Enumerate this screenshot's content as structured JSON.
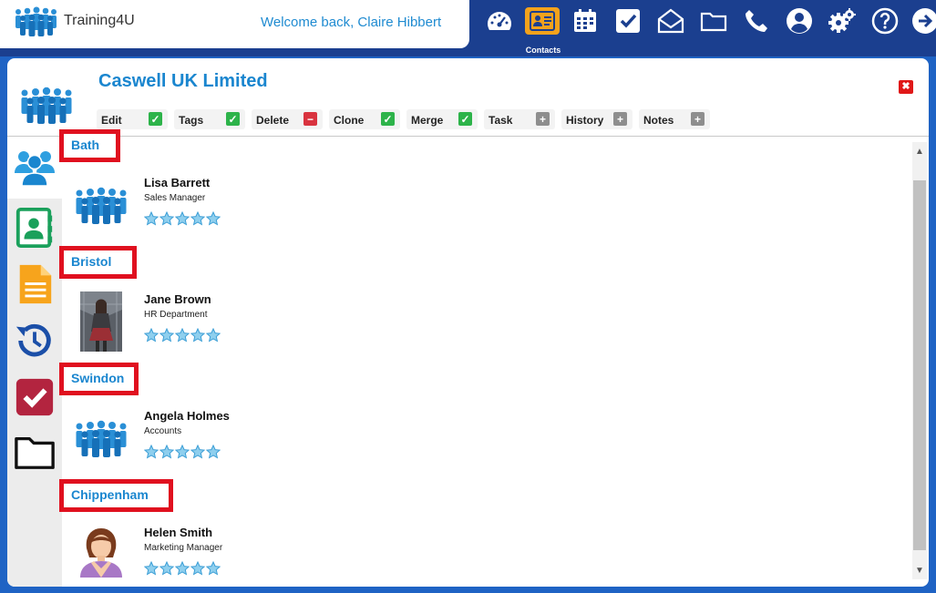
{
  "app": {
    "name": "Training4U",
    "welcome": "Welcome back, Claire Hibbert"
  },
  "nav": {
    "items": [
      {
        "icon": "dashboard-icon"
      },
      {
        "icon": "contacts-icon",
        "label": "Contacts",
        "active": true
      },
      {
        "icon": "calendar-icon"
      },
      {
        "icon": "tasks-icon"
      },
      {
        "icon": "mail-icon"
      },
      {
        "icon": "folder-icon"
      },
      {
        "icon": "phone-icon"
      },
      {
        "icon": "user-icon"
      },
      {
        "icon": "settings-icon"
      },
      {
        "icon": "help-icon"
      },
      {
        "icon": "logout-icon"
      }
    ]
  },
  "company": {
    "title": "Caswell UK Limited",
    "close": "✖"
  },
  "actions": [
    {
      "label": "Edit",
      "badge": "✓",
      "type": "green"
    },
    {
      "label": "Tags",
      "badge": "✓",
      "type": "green"
    },
    {
      "label": "Delete",
      "badge": "−",
      "type": "red"
    },
    {
      "label": "Clone",
      "badge": "✓",
      "type": "green"
    },
    {
      "label": "Merge",
      "badge": "✓",
      "type": "green"
    },
    {
      "label": "Task",
      "badge": "+",
      "type": "grey"
    },
    {
      "label": "History",
      "badge": "+",
      "type": "grey"
    },
    {
      "label": "Notes",
      "badge": "+",
      "type": "grey"
    }
  ],
  "rail": [
    {
      "icon": "people-icon"
    },
    {
      "icon": "address-book-icon"
    },
    {
      "icon": "document-icon"
    },
    {
      "icon": "history-icon"
    },
    {
      "icon": "checkbox-icon"
    },
    {
      "icon": "folder-icon"
    }
  ],
  "groups": [
    {
      "name": "Bath",
      "contact": {
        "name": "Lisa Barrett",
        "role": "Sales Manager",
        "avatar": "group-avatar",
        "rating": 5
      }
    },
    {
      "name": "Bristol",
      "contact": {
        "name": "Jane Brown",
        "role": "HR Department",
        "avatar": "photo-avatar",
        "rating": 5
      }
    },
    {
      "name": "Swindon",
      "contact": {
        "name": "Angela Holmes",
        "role": "Accounts",
        "avatar": "group-avatar",
        "rating": 5
      }
    },
    {
      "name": "Chippenham",
      "contact": {
        "name": "Helen Smith",
        "role": "Marketing Manager",
        "avatar": "female-avatar",
        "rating": 5
      }
    }
  ],
  "colors": {
    "brand_blue": "#1a86cf",
    "header_navy": "#1b3f8f",
    "highlight_red": "#e0101f",
    "active_orange": "#f3a21c"
  }
}
